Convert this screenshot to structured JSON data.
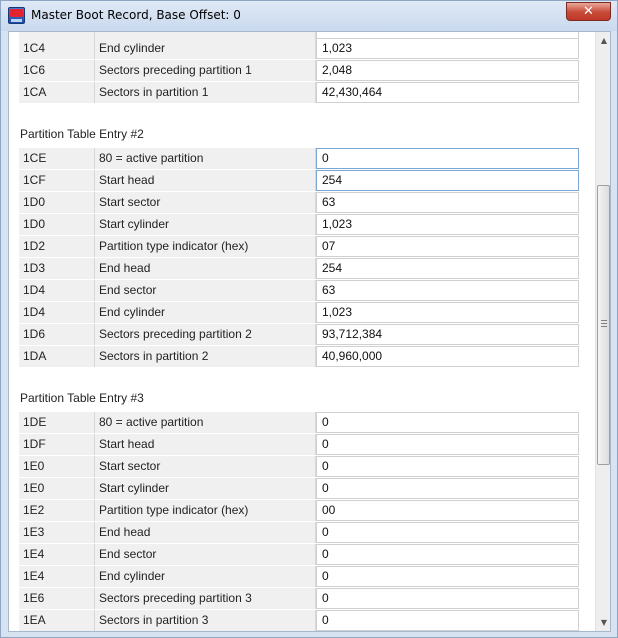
{
  "window": {
    "title": "Master Boot Record, Base Offset: 0",
    "close_label": "✕"
  },
  "entry1_tail": [
    {
      "offset": "1C4",
      "field": "End cylinder",
      "value": "1,023"
    },
    {
      "offset": "1C6",
      "field": "Sectors preceding partition 1",
      "value": "2,048"
    },
    {
      "offset": "1CA",
      "field": "Sectors in partition 1",
      "value": "42,430,464"
    }
  ],
  "entry2": {
    "title": "Partition Table Entry #2",
    "rows": [
      {
        "offset": "1CE",
        "field": "80 = active partition",
        "value": "0"
      },
      {
        "offset": "1CF",
        "field": "Start head",
        "value": "254"
      },
      {
        "offset": "1D0",
        "field": "Start sector",
        "value": "63"
      },
      {
        "offset": "1D0",
        "field": "Start cylinder",
        "value": "1,023"
      },
      {
        "offset": "1D2",
        "field": "Partition type indicator (hex)",
        "value": "07"
      },
      {
        "offset": "1D3",
        "field": "End head",
        "value": "254"
      },
      {
        "offset": "1D4",
        "field": "End sector",
        "value": "63"
      },
      {
        "offset": "1D4",
        "field": "End cylinder",
        "value": "1,023"
      },
      {
        "offset": "1D6",
        "field": "Sectors preceding partition 2",
        "value": "93,712,384"
      },
      {
        "offset": "1DA",
        "field": "Sectors in partition 2",
        "value": "40,960,000"
      }
    ]
  },
  "entry3": {
    "title": "Partition Table Entry #3",
    "rows": [
      {
        "offset": "1DE",
        "field": "80 = active partition",
        "value": "0"
      },
      {
        "offset": "1DF",
        "field": "Start head",
        "value": "0"
      },
      {
        "offset": "1E0",
        "field": "Start sector",
        "value": "0"
      },
      {
        "offset": "1E0",
        "field": "Start cylinder",
        "value": "0"
      },
      {
        "offset": "1E2",
        "field": "Partition type indicator (hex)",
        "value": "00"
      },
      {
        "offset": "1E3",
        "field": "End head",
        "value": "0"
      },
      {
        "offset": "1E4",
        "field": "End sector",
        "value": "0"
      },
      {
        "offset": "1E4",
        "field": "End cylinder",
        "value": "0"
      },
      {
        "offset": "1E6",
        "field": "Sectors preceding partition 3",
        "value": "0"
      },
      {
        "offset": "1EA",
        "field": "Sectors in partition 3",
        "value": "0"
      }
    ]
  },
  "scrollbar": {
    "up_icon": "scroll-up-arrow",
    "down_icon": "scroll-down-arrow"
  }
}
